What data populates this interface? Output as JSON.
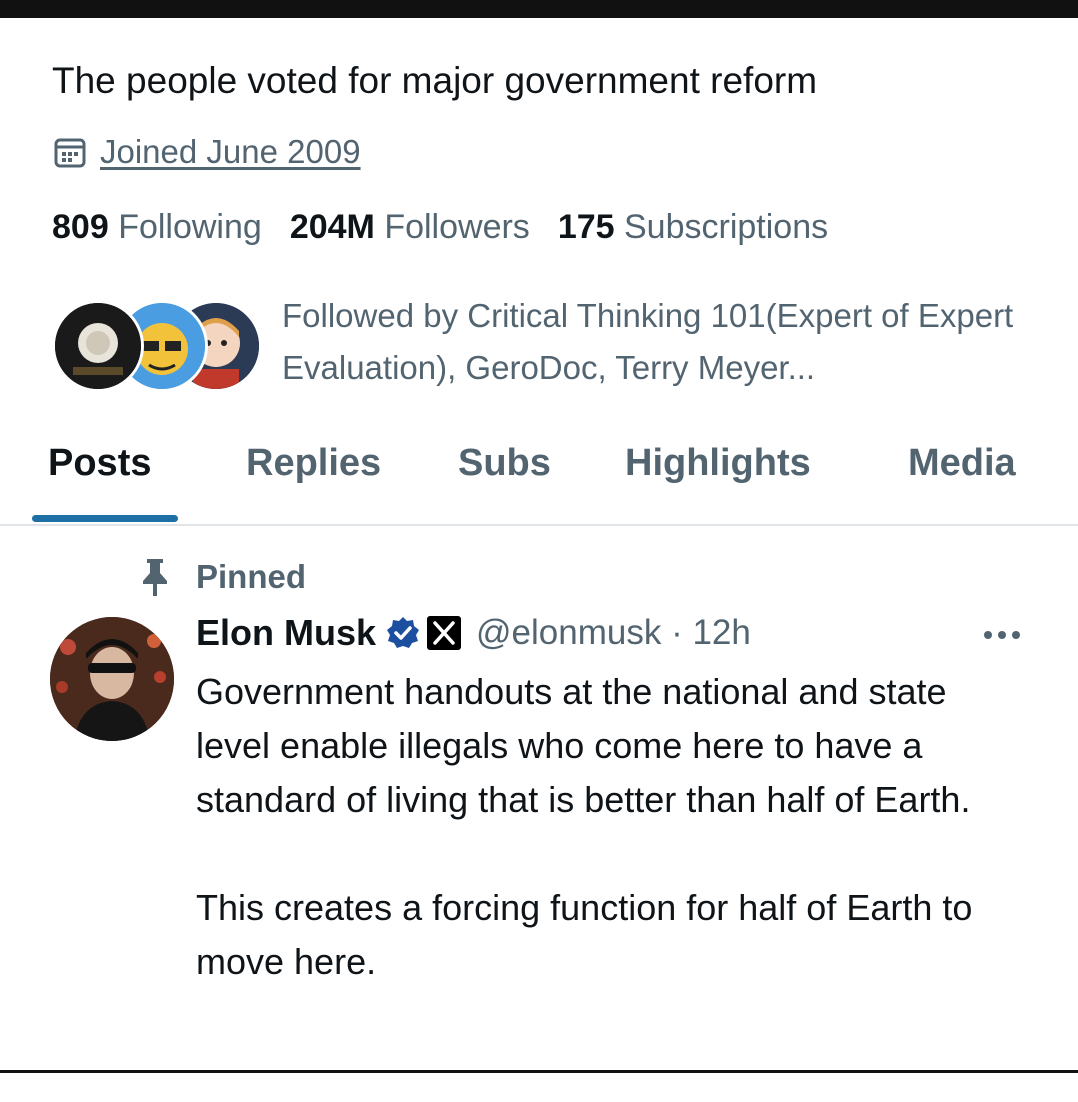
{
  "profile": {
    "bio": "The people voted for major government reform",
    "joined": "Joined June 2009",
    "stats": [
      {
        "num": "809",
        "label": "Following"
      },
      {
        "num": "204M",
        "label": "Followers"
      },
      {
        "num": "175",
        "label": "Subscriptions"
      }
    ],
    "followed_by": "Followed by Critical Thinking 101(Expert of Expert Evaluation), GeroDoc, Terry Meyer..."
  },
  "tabs": [
    {
      "label": "Posts",
      "active": true
    },
    {
      "label": "Replies",
      "active": false
    },
    {
      "label": "Subs",
      "active": false
    },
    {
      "label": "Highlights",
      "active": false
    },
    {
      "label": "Media",
      "active": false
    }
  ],
  "post": {
    "pinned_label": "Pinned",
    "author": "Elon Musk",
    "handle_time": "@elonmusk · 12h",
    "paragraphs": [
      "Government handouts at the national and state level enable illegals who come here to have a standard of living that is better than half of Earth.",
      "This creates a forcing function for half of Earth to move here."
    ]
  },
  "colors": {
    "accent": "#1d6fa5",
    "verified": "#1d4fa0",
    "muted_text": "#536471",
    "text": "#0f1419"
  },
  "icons": [
    "calendar-icon",
    "pin-icon",
    "verified-badge-icon",
    "x-logo-icon",
    "more-options-icon"
  ]
}
